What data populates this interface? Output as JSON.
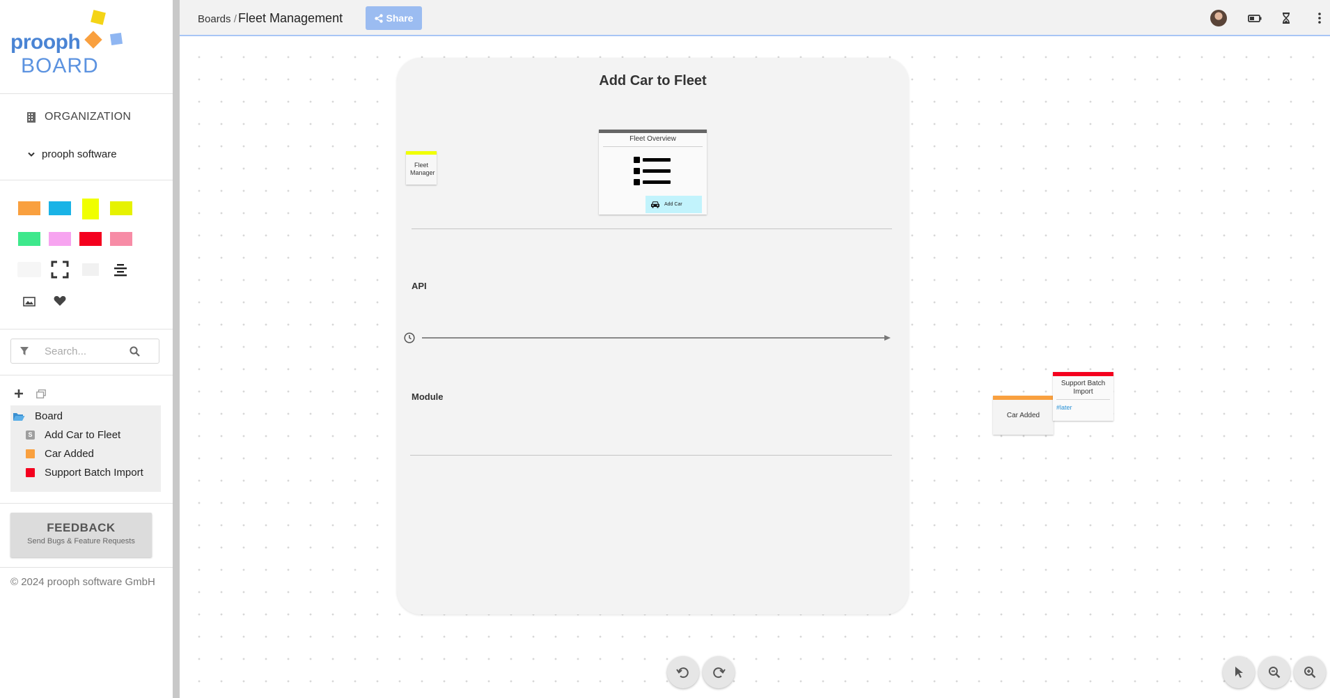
{
  "logo": {
    "word": "prooph",
    "product": "BOARD"
  },
  "sidebar": {
    "org_label": "ORGANIZATION",
    "workspace": "prooph software",
    "palette_colors": [
      "#f9a03f",
      "#1ab3e6",
      "#f0ff00",
      "#e6f200",
      "#3ee88c",
      "#f7a4f0",
      "#f4001e",
      "#f78ca6"
    ],
    "search_placeholder": "Search...",
    "tree": {
      "root": "Board",
      "items": [
        {
          "label": "Add Car to Fleet",
          "icon": "slice-icon",
          "color": "#9e9e9e"
        },
        {
          "label": "Car Added",
          "icon": "event-icon",
          "color": "#f9a03f"
        },
        {
          "label": "Support Batch Import",
          "icon": "hotspot-icon",
          "color": "#f4001e"
        }
      ]
    },
    "feedback": {
      "title": "FEEDBACK",
      "subtitle": "Send Bugs & Feature Requests"
    },
    "copyright": "© 2024 prooph software GmbH"
  },
  "topbar": {
    "breadcrumb_root": "Boards",
    "breadcrumb_sep": "/",
    "board_title": "Fleet Management",
    "share_label": "Share"
  },
  "board": {
    "slice_title": "Add Car to Fleet",
    "lanes": {
      "api": "API",
      "module": "Module"
    },
    "actor": {
      "label": "Fleet Manager",
      "color": "#f0ff00"
    },
    "ui_card": {
      "title": "Fleet Overview",
      "button_label": "Add Car"
    },
    "event": {
      "label": "Car Added",
      "color": "#f9a03f"
    },
    "hotspot": {
      "label": "Support Batch Import",
      "tag": "#later",
      "color": "#f4001e"
    }
  }
}
